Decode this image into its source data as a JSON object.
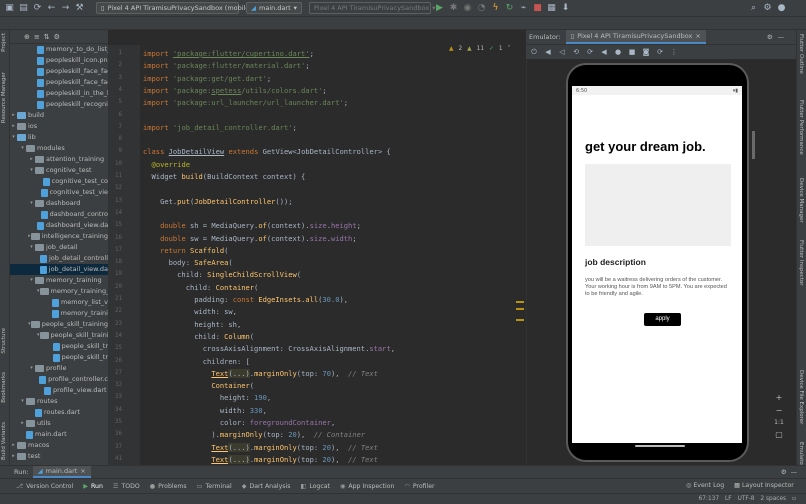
{
  "toolbar": {
    "device": "Pixel 4 API TiramisuPrivacySandbox (mobile)",
    "run_config": "main.dart",
    "target_device": "Pixel 4 API TiramisuPrivacySandbox"
  },
  "left_strip": {
    "project": "Project",
    "resource_manager": "Resource Manager",
    "structure": "Structure",
    "bookmarks": "Bookmarks",
    "build_variants": "Build Variants"
  },
  "right_strip": {
    "flutter_outline": "Flutter Outline",
    "flutter_performance": "Flutter Performance",
    "device_manager": "Device Manager",
    "flutter_inspector": "Flutter Inspector",
    "device_file_explorer": "Device File Explorer",
    "emulator": "Emulator"
  },
  "project_tree": [
    {
      "label": "memory_to_do_list_",
      "indent": 3,
      "kind": "file"
    },
    {
      "label": "peopleskill_icon.png",
      "indent": 3,
      "kind": "file"
    },
    {
      "label": "peopleskill_face_fac",
      "indent": 3,
      "kind": "file"
    },
    {
      "label": "peopleskill_face_fac",
      "indent": 3,
      "kind": "file"
    },
    {
      "label": "peopleskill_in_the_k",
      "indent": 3,
      "kind": "file"
    },
    {
      "label": "peopleskill_recogniti",
      "indent": 3,
      "kind": "file"
    },
    {
      "label": "build",
      "indent": 0,
      "kind": "folder",
      "arrow": "▸",
      "blue": true
    },
    {
      "label": "ios",
      "indent": 0,
      "kind": "folder",
      "arrow": "▸"
    },
    {
      "label": "lib",
      "indent": 0,
      "kind": "folder",
      "arrow": "▾",
      "blue": true
    },
    {
      "label": "modules",
      "indent": 1,
      "kind": "folder",
      "arrow": "▾"
    },
    {
      "label": "attention_training",
      "indent": 2,
      "kind": "folder",
      "arrow": "▸"
    },
    {
      "label": "cognitive_test",
      "indent": 2,
      "kind": "folder",
      "arrow": "▾"
    },
    {
      "label": "cognitive_test_co",
      "indent": 3,
      "kind": "file"
    },
    {
      "label": "cognitive_test_vie",
      "indent": 3,
      "kind": "file"
    },
    {
      "label": "dashboard",
      "indent": 2,
      "kind": "folder",
      "arrow": "▾"
    },
    {
      "label": "dashboard_contro",
      "indent": 3,
      "kind": "file"
    },
    {
      "label": "dashboard_view.dar",
      "indent": 3,
      "kind": "file"
    },
    {
      "label": "intelligence_training",
      "indent": 2,
      "kind": "folder",
      "arrow": "▸"
    },
    {
      "label": "job_detail",
      "indent": 2,
      "kind": "folder",
      "arrow": "▾"
    },
    {
      "label": "job_detail_controll",
      "indent": 3,
      "kind": "file"
    },
    {
      "label": "job_detail_view.da",
      "indent": 3,
      "kind": "file",
      "selected": true
    },
    {
      "label": "memory_training",
      "indent": 2,
      "kind": "folder",
      "arrow": "▾"
    },
    {
      "label": "memory_training_",
      "indent": 3,
      "kind": "folder",
      "arrow": "▾"
    },
    {
      "label": "memory_list_v",
      "indent": 4,
      "kind": "file"
    },
    {
      "label": "memory_traini",
      "indent": 4,
      "kind": "file"
    },
    {
      "label": "people_skill_training",
      "indent": 2,
      "kind": "folder",
      "arrow": "▾"
    },
    {
      "label": "people_skill_traini",
      "indent": 3,
      "kind": "folder",
      "arrow": "▾"
    },
    {
      "label": "people_skill_tr",
      "indent": 4,
      "kind": "file"
    },
    {
      "label": "people_skill_tr",
      "indent": 4,
      "kind": "file"
    },
    {
      "label": "profile",
      "indent": 2,
      "kind": "folder",
      "arrow": "▾"
    },
    {
      "label": "profile_controller.c",
      "indent": 3,
      "kind": "file"
    },
    {
      "label": "profile_view.dart",
      "indent": 3,
      "kind": "file"
    },
    {
      "label": "routes",
      "indent": 1,
      "kind": "folder",
      "arrow": "▾"
    },
    {
      "label": "routes.dart",
      "indent": 2,
      "kind": "file"
    },
    {
      "label": "utils",
      "indent": 1,
      "kind": "folder",
      "arrow": "▸"
    },
    {
      "label": "main.dart",
      "indent": 1,
      "kind": "file"
    },
    {
      "label": "macos",
      "indent": 0,
      "kind": "folder",
      "arrow": "▸"
    },
    {
      "label": "test",
      "indent": 0,
      "kind": "folder",
      "arrow": "▸"
    }
  ],
  "editor_tabs": [
    {
      "label": "job_detail_view.dart",
      "active": true
    },
    {
      "label": "dashboard_view.dart"
    },
    {
      "label": "cognitive_test_view.dart"
    },
    {
      "label": "people_skill_training_list_controller.dart"
    }
  ],
  "inspections": {
    "warnings": "2",
    "weak": "11",
    "ok": "1"
  },
  "code_lines": [
    {
      "n": "1",
      "html": "<span class='kw'>import</span> <span class='str ul'>'package:flutter/cupertino.dart'</span>;"
    },
    {
      "n": "2",
      "html": "<span class='kw'>import</span> <span class='str'>'package:flutter/material.dart'</span>;"
    },
    {
      "n": "3",
      "html": "<span class='kw'>import</span> <span class='str'>'package:get/get.dart'</span>;"
    },
    {
      "n": "4",
      "html": "<span class='kw'>import</span> <span class='str'>'package:<span class=\"ul\">spetess</span>/utils/colors.dart'</span>;"
    },
    {
      "n": "5",
      "html": "<span class='kw'>import</span> <span class='str'>'package:url_launcher/url_launcher.dart'</span>;"
    },
    {
      "n": "6",
      "html": ""
    },
    {
      "n": "7",
      "html": "<span class='kw'>import</span> <span class='str'>'job_detail_controller.dart'</span>;"
    },
    {
      "n": "8",
      "html": ""
    },
    {
      "n": "9",
      "html": "<span class='kw'>class</span> <span class='ul'>JobDetailView</span> <span class='kw'>extends</span> GetView&lt;JobDetailController&gt; {"
    },
    {
      "n": "10",
      "html": "  <span class='ann'>@override</span>"
    },
    {
      "n": "11",
      "html": "  Widget <span class='cls'>build</span>(BuildContext context) {"
    },
    {
      "n": "12",
      "html": ""
    },
    {
      "n": "13",
      "html": "    Get.<span class='cls'>put</span>(<span class='cls'>JobDetailController</span>());"
    },
    {
      "n": "14",
      "html": ""
    },
    {
      "n": "15",
      "html": "    <span class='kw'>double</span> sh = MediaQuery.<span class='cls'>of</span>(context).<span class='fld'>size</span>.<span class='fld'>height</span>;"
    },
    {
      "n": "16",
      "html": "    <span class='kw'>double</span> sw = MediaQuery.<span class='cls'>of</span>(context).<span class='fld'>size</span>.<span class='fld'>width</span>;"
    },
    {
      "n": "17",
      "html": "    <span class='kw'>return</span> <span class='cls'>Scaffold</span>("
    },
    {
      "n": "18",
      "html": "      body: <span class='cls'>SafeArea</span>("
    },
    {
      "n": "19",
      "html": "        child: <span class='cls'>SingleChildScrollView</span>("
    },
    {
      "n": "20",
      "html": "          child: <span class='cls'>Container</span>("
    },
    {
      "n": "21",
      "html": "            padding: <span class='kw'>const</span> <span class='cls'>EdgeInsets.all</span>(<span class='num'>30.0</span>),"
    },
    {
      "n": "22",
      "html": "            width: sw,"
    },
    {
      "n": "23",
      "html": "            height: sh,"
    },
    {
      "n": "24",
      "html": "            child: <span class='cls'>Column</span>("
    },
    {
      "n": "25",
      "html": "              crossAxisAlignment: CrossAxisAlignment.<span class='fld'>start</span>,"
    },
    {
      "n": "26",
      "html": "              children: ["
    },
    {
      "n": "27",
      "html": "                <span class='cls ul'>Text</span><span class='hl'>(...)</span>.<span class='cls'>marginOnly</span>(top: <span class='num'>70</span>),  <span class='cm'>// Text</span>"
    },
    {
      "n": "32",
      "html": "                <span class='cls'>Container</span>("
    },
    {
      "n": "33",
      "html": "                  height: <span class='num'>190</span>,"
    },
    {
      "n": "34",
      "html": "                  width: <span class='num'>330</span>,"
    },
    {
      "n": "35",
      "html": "                  color: <span class='fld'>foregroundContainer</span>,"
    },
    {
      "n": "36",
      "html": "                ).<span class='cls'>marginOnly</span>(top: <span class='num'>20</span>),  <span class='cm'>// Container</span>"
    },
    {
      "n": "37",
      "html": "                <span class='cls ul'>Text</span><span class='hl'>(...)</span>.<span class='cls'>marginOnly</span>(top: <span class='num'>20</span>),  <span class='cm'>// Text</span>"
    },
    {
      "n": "41",
      "html": "                <span class='cls ul'>Text</span><span class='hl'>(...)</span>.<span class='cls'>marginOnly</span>(top: <span class='num'>20</span>),  <span class='cm'>// Text</span>"
    }
  ],
  "emulator": {
    "label": "Emulator:",
    "device_tab": "Pixel 4 API TiramisuPrivacySandbox",
    "time": "6:50"
  },
  "app": {
    "headline": "get your dream job.",
    "jd_title": "job description",
    "jd_body": "you will be a waitress delivering orders of the customer. Your working hour is from 9AM to 5PM. You are expected to be friendly and agile.",
    "apply": "apply"
  },
  "zoom": {
    "plus": "+",
    "minus": "−",
    "ratio": "1:1"
  },
  "run_bar": {
    "run_label": "Run:",
    "config": "main.dart"
  },
  "bottom_tabs": [
    {
      "label": "Version Control",
      "icon": "branch-icon",
      "glyph": "⎇"
    },
    {
      "label": "Run",
      "icon": "play-icon",
      "glyph": "▶",
      "active": true
    },
    {
      "label": "TODO",
      "icon": "list-icon",
      "glyph": "☰"
    },
    {
      "label": "Problems",
      "icon": "warning-icon",
      "glyph": "●"
    },
    {
      "label": "Terminal",
      "icon": "terminal-icon",
      "glyph": "▭"
    },
    {
      "label": "Dart Analysis",
      "icon": "dart-icon",
      "glyph": "◆"
    },
    {
      "label": "Logcat",
      "icon": "logcat-icon",
      "glyph": "◧"
    },
    {
      "label": "App Inspection",
      "icon": "inspect-icon",
      "glyph": "◉"
    },
    {
      "label": "Profiler",
      "icon": "profiler-icon",
      "glyph": "◠"
    }
  ],
  "bottom_right": {
    "event_log": "Event Log",
    "layout_inspector": "Layout Inspector"
  },
  "status": {
    "position": "67:137",
    "line_sep": "LF",
    "encoding": "UTF-8",
    "indent": "2 spaces"
  },
  "colors": {
    "accent": "#4a88c7",
    "selection": "#0d293e",
    "keyword": "#cc7832",
    "string": "#6a8759"
  }
}
